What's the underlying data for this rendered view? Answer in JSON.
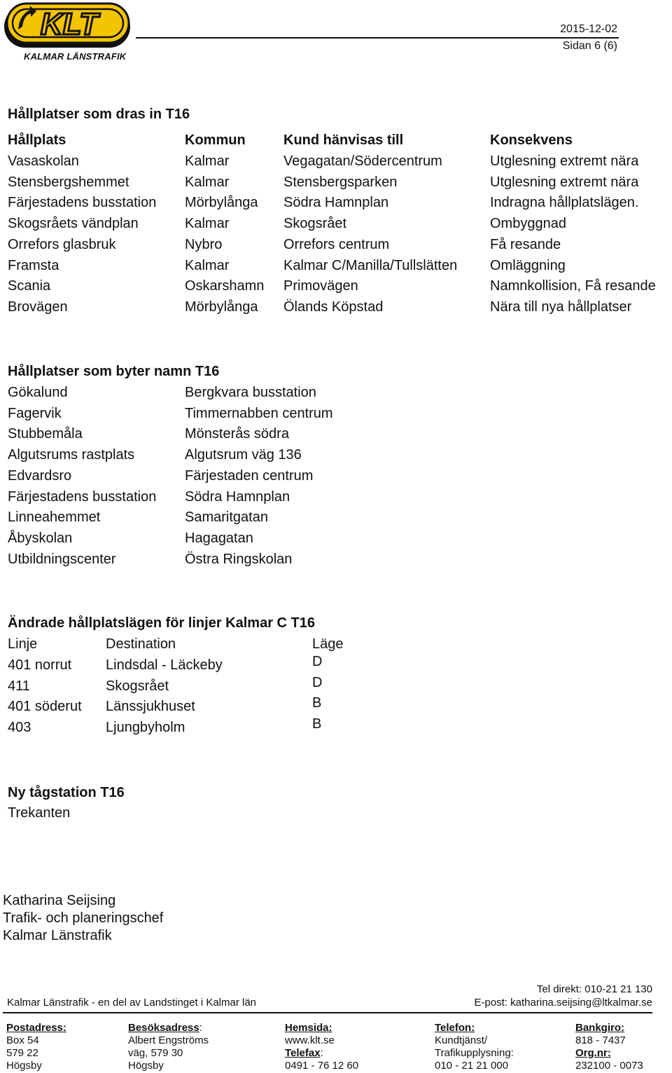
{
  "header": {
    "logo_text": "KLT",
    "logo_caption": "KALMAR LÄNSTRAFIK",
    "date": "2015-12-02",
    "page": "Sidan 6 (6)",
    "brand_colors": {
      "yellow": "#F5C400",
      "black": "#111111"
    }
  },
  "section_removed": {
    "title": "Hållplatser som dras in T16",
    "columns": [
      "Hållplats",
      "Kommun",
      "Kund hänvisas till",
      "Konsekvens"
    ],
    "rows": [
      [
        "Vasaskolan",
        "Kalmar",
        "Vegagatan/Södercentrum",
        "Utglesning extremt nära"
      ],
      [
        "Stensbergshemmet",
        "Kalmar",
        "Stensbergsparken",
        "Utglesning extremt nära"
      ],
      [
        "Färjestadens busstation",
        "Mörbylånga",
        "Södra Hamnplan",
        "Indragna hållplatslägen."
      ],
      [
        "Skogsråets vändplan",
        "Kalmar",
        "Skogsrået",
        "Ombyggnad"
      ],
      [
        "Orrefors glasbruk",
        "Nybro",
        "Orrefors centrum",
        "Få resande"
      ],
      [
        "Framsta",
        "Kalmar",
        "Kalmar C/Manilla/Tullslätten",
        "Omläggning"
      ],
      [
        "Scania",
        "Oskarshamn",
        "Primovägen",
        "Namnkollision, Få resande"
      ],
      [
        "Brovägen",
        "Mörbylånga",
        "Ölands Köpstad",
        "Nära till nya hållplatser"
      ]
    ]
  },
  "section_renamed": {
    "title": "Hållplatser som byter namn T16",
    "rows": [
      [
        "Gökalund",
        "Bergkvara busstation"
      ],
      [
        "Fagervik",
        "Timmernabben centrum"
      ],
      [
        "Stubbemåla",
        "Mönsterås södra"
      ],
      [
        "Algutsrums rastplats",
        "Algutsrum väg 136"
      ],
      [
        "Edvardsro",
        "Färjestaden centrum"
      ],
      [
        "Färjestadens busstation",
        "Södra Hamnplan"
      ],
      [
        "Linneahemmet",
        "Samaritgatan"
      ],
      [
        "Åbyskolan",
        "Hagagatan"
      ],
      [
        "Utbildningscenter",
        "Östra Ringskolan"
      ]
    ]
  },
  "section_positions": {
    "title": "Ändrade hållplatslägen för linjer Kalmar C T16",
    "columns": [
      "Linje",
      "Destination",
      "Läge"
    ],
    "rows": [
      [
        "401 norrut",
        "Lindsdal - Läckeby",
        "D"
      ],
      [
        "411",
        "Skogsrået",
        "D"
      ],
      [
        "401 söderut",
        "Länssjukhuset",
        "B"
      ],
      [
        "403",
        "Ljungbyholm",
        "B"
      ]
    ]
  },
  "section_station": {
    "title": "Ny tågstation T16",
    "name": "Trekanten"
  },
  "signature": {
    "name": "Katharina Seijsing",
    "role": "Trafik- och planeringschef",
    "org": "Kalmar Länstrafik"
  },
  "footer": {
    "org_line": "Kalmar Länstrafik - en del av Landstinget i Kalmar län",
    "tel_direct": "Tel direkt: 010-21 21 130",
    "email": "E-post: katharina.seijsing@ltkalmar.se",
    "postadress": {
      "label": "Postadress:",
      "lines": [
        "Box 54",
        "579 22",
        "Högsby"
      ]
    },
    "besoksadress": {
      "label": "Besöksadress",
      "suffix": ":",
      "lines": [
        "Albert Engströms",
        "väg, 579 30",
        "Högsby"
      ]
    },
    "hemsida": {
      "label": "Hemsida:",
      "value": "www.klt.se"
    },
    "telefax": {
      "label": "Telefax",
      "suffix": ":",
      "value": "0491 - 76 12 60"
    },
    "telefon": {
      "label": "Telefon:",
      "lines": [
        "Kundtjänst/",
        "Trafikupplysning:",
        "010 - 21 21 000"
      ]
    },
    "bankgiro": {
      "label": "Bankgiro:",
      "value": "818 - 7437"
    },
    "orgnr": {
      "label": "Org.nr:",
      "value": "232100 - 0073"
    }
  }
}
